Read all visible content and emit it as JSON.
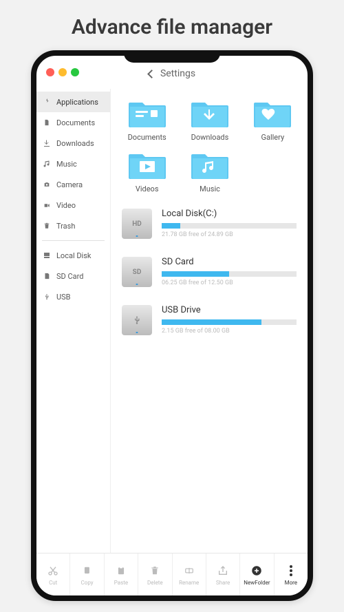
{
  "page_title": "Advance file manager",
  "header": {
    "title": "Settings"
  },
  "sidebar": {
    "items": [
      {
        "label": "Applications",
        "icon": "apps",
        "active": true
      },
      {
        "label": "Documents",
        "icon": "doc"
      },
      {
        "label": "Downloads",
        "icon": "download"
      },
      {
        "label": "Music",
        "icon": "music"
      },
      {
        "label": "Camera",
        "icon": "camera"
      },
      {
        "label": "Video",
        "icon": "video"
      },
      {
        "label": "Trash",
        "icon": "trash"
      }
    ],
    "storage": [
      {
        "label": "Local Disk",
        "icon": "disk"
      },
      {
        "label": "SD Card",
        "icon": "sd"
      },
      {
        "label": "USB",
        "icon": "usb"
      }
    ]
  },
  "folders": [
    {
      "label": "Documents",
      "overlay": "doc"
    },
    {
      "label": "Downloads",
      "overlay": "download"
    },
    {
      "label": "Gallery",
      "overlay": "gallery"
    },
    {
      "label": "Videos",
      "overlay": "video"
    },
    {
      "label": "Music",
      "overlay": "music"
    }
  ],
  "drives": [
    {
      "name": "Local Disk(C:)",
      "badge": "HD",
      "used_pct": 14,
      "free_text": "21.78 GB free of 24.89 GB"
    },
    {
      "name": "SD Card",
      "badge": "SD",
      "used_pct": 50,
      "free_text": "06.25 GB free of 12.50 GB"
    },
    {
      "name": "USB Drive",
      "badge": "usb",
      "used_pct": 74,
      "free_text": "2.15 GB free of 08.00 GB"
    }
  ],
  "toolbar": [
    {
      "label": "Cut",
      "icon": "cut"
    },
    {
      "label": "Copy",
      "icon": "copy"
    },
    {
      "label": "Paste",
      "icon": "paste"
    },
    {
      "label": "Delete",
      "icon": "delete"
    },
    {
      "label": "Rename",
      "icon": "rename"
    },
    {
      "label": "Share",
      "icon": "share"
    },
    {
      "label": "NewFolder",
      "icon": "newfolder",
      "dark": true
    },
    {
      "label": "More",
      "icon": "more",
      "dark": true
    }
  ]
}
